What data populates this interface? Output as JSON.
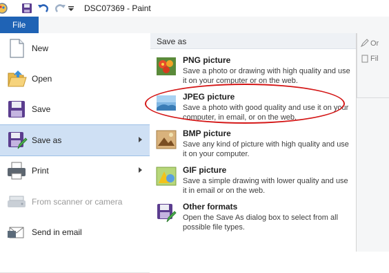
{
  "window": {
    "title": "DSC07369 - Paint"
  },
  "quick_access": {
    "icons": [
      "paint-app-icon",
      "save-icon",
      "undo-icon",
      "redo-icon",
      "customize-dropdown-icon"
    ]
  },
  "ribbon": {
    "file_tab": "File",
    "right_items": [
      "Or",
      "Fil"
    ]
  },
  "file_menu": {
    "items": [
      {
        "label": "New",
        "icon": "new-file-icon",
        "disabled": false,
        "submenu": false
      },
      {
        "label": "Open",
        "icon": "open-folder-icon",
        "disabled": false,
        "submenu": false
      },
      {
        "label": "Save",
        "icon": "save-disk-icon",
        "disabled": false,
        "submenu": false
      },
      {
        "label": "Save as",
        "icon": "save-as-icon",
        "disabled": false,
        "submenu": true,
        "selected": true
      },
      {
        "label": "Print",
        "icon": "printer-icon",
        "disabled": false,
        "submenu": true
      },
      {
        "label": "From scanner or camera",
        "icon": "scanner-icon",
        "disabled": true,
        "submenu": false
      },
      {
        "label": "Send in email",
        "icon": "email-icon",
        "disabled": false,
        "submenu": false
      }
    ]
  },
  "save_as_panel": {
    "header": "Save as",
    "items": [
      {
        "title": "PNG picture",
        "description": "Save a photo or drawing with high quality and use it on your computer or on the web.",
        "icon": "png-picture-icon"
      },
      {
        "title": "JPEG picture",
        "description": "Save a photo with good quality and use it on your computer, in email, or on the web.",
        "icon": "jpeg-picture-icon"
      },
      {
        "title": "BMP picture",
        "description": "Save any kind of picture with high quality and use it on your computer.",
        "icon": "bmp-picture-icon"
      },
      {
        "title": "GIF picture",
        "description": "Save a simple drawing with lower quality and use it in email or on the web.",
        "icon": "gif-picture-icon"
      },
      {
        "title": "Other formats",
        "description": "Open the Save As dialog box to select from all possible file types.",
        "icon": "other-formats-icon"
      }
    ]
  },
  "colors": {
    "file_tab": "#1f63b5",
    "selected_item": "#cfe0f4",
    "highlight_oval": "#d41717"
  }
}
